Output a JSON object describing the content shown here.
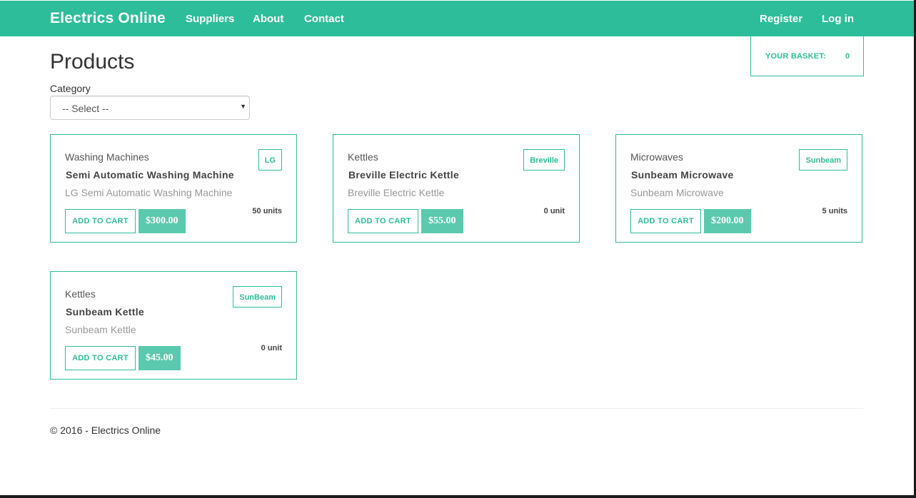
{
  "navbar": {
    "brand": "Electrics Online",
    "links": [
      "Suppliers",
      "About",
      "Contact"
    ],
    "right_links": [
      "Register",
      "Log in"
    ],
    "color": "#2ebd9b"
  },
  "page": {
    "title": "Products"
  },
  "basket": {
    "label": "YOUR BASKET:",
    "count": "0"
  },
  "filter": {
    "label": "Category",
    "selected": "-- Select --"
  },
  "products": [
    {
      "category": "Washing Machines",
      "name": "Semi Automatic Washing Machine",
      "description": "LG Semi Automatic Washing Machine",
      "brand": "LG",
      "stock": "50 units",
      "add_label": "ADD TO CART",
      "price": "$300.00"
    },
    {
      "category": "Kettles",
      "name": "Breville Electric Kettle",
      "description": "Breville Electric Kettle",
      "brand": "Breville",
      "stock": "0 unit",
      "add_label": "ADD TO CART",
      "price": "$55.00"
    },
    {
      "category": "Microwaves",
      "name": "Sunbeam Microwave",
      "description": "Sunbeam Microwave",
      "brand": "Sunbeam",
      "stock": "5 units",
      "add_label": "ADD TO CART",
      "price": "$200.00"
    },
    {
      "category": "Kettles",
      "name": "Sunbeam Kettle",
      "description": "Sunbeam Kettle",
      "brand": "SunBeam",
      "stock": "0 unit",
      "add_label": "ADD TO CART",
      "price": "$45.00"
    }
  ],
  "footer": {
    "text": "© 2016 - Electrics Online"
  }
}
